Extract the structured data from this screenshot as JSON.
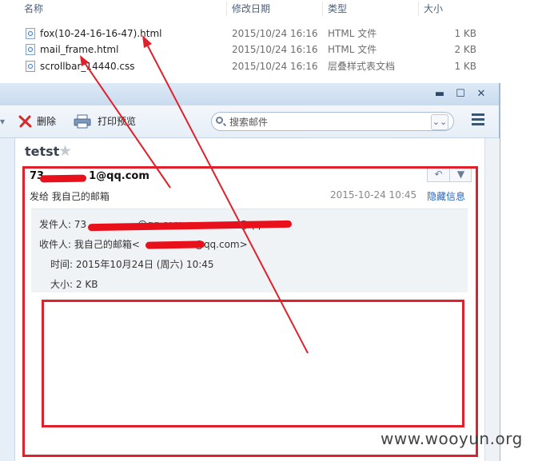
{
  "explorer": {
    "columns": {
      "name": "名称",
      "date": "修改日期",
      "type": "类型",
      "size": "大小"
    },
    "files": [
      {
        "name": "fox(10-24-16-16-47).html",
        "date": "2015/10/24 16:16",
        "type": "HTML 文件",
        "size": "1 KB"
      },
      {
        "name": "mail_frame.html",
        "date": "2015/10/24 16:16",
        "type": "HTML 文件",
        "size": "2 KB"
      },
      {
        "name": "scrollbar_14440.css",
        "date": "2015/10/24 16:16",
        "type": "层叠样式表文档",
        "size": "1 KB"
      }
    ]
  },
  "window": {
    "buttons": {
      "minimize": "▬",
      "maximize": "☐",
      "close": "✕"
    }
  },
  "toolbar": {
    "delete_label": "删除",
    "print_label": "打印预览",
    "search_placeholder": "搜索邮件",
    "search_dropdown": "⌄⌄"
  },
  "mail": {
    "subject": "tetst",
    "sender_visible": "73",
    "sender_suffix": "1@qq.com",
    "sent_to_line": "发给 我自己的邮箱",
    "date": "2015-10-24 10:45",
    "hide_info": "隐藏信息",
    "details": {
      "from_label": "发件人:",
      "from_value": "73",
      "from_mid": "@qq.com<",
      "from_tail": "@qq.com>",
      "to_label": "收件人:",
      "to_value": "我自己的邮箱<",
      "to_tail": "@qq.com>",
      "time_label": "时间:",
      "time_value": "2015年10月24日 (周六) 10:45",
      "size_label": "大小:",
      "size_value": "2 KB"
    }
  },
  "watermark": "www.wooyun.org",
  "colors": {
    "annotation": "#e0202b",
    "link": "#2a66b8",
    "window_chrome": "#d6e3f1"
  }
}
